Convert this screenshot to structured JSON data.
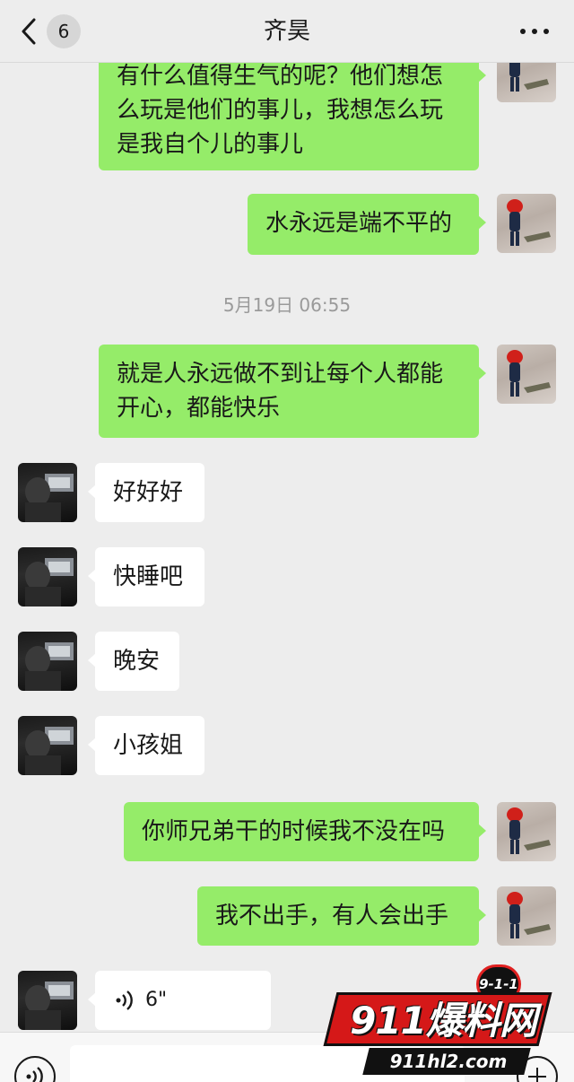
{
  "header": {
    "unread_count": "6",
    "title": "齐昊"
  },
  "messages": [
    {
      "side": "self",
      "text": "有什么值得生气的呢？他们想怎\n么玩是他们的事儿，我想怎么玩\n是我自个儿的事儿"
    },
    {
      "side": "self",
      "text": "水永远是端不平的"
    },
    {
      "type": "time",
      "text": "5月19日 06:55"
    },
    {
      "side": "self",
      "text": "就是人永远做不到让每个人都能\n开心，都能快乐"
    },
    {
      "side": "other",
      "text": "好好好"
    },
    {
      "side": "other",
      "text": "快睡吧"
    },
    {
      "side": "other",
      "text": "晚安"
    },
    {
      "side": "other",
      "text": "小孩姐"
    },
    {
      "side": "self",
      "text": "你师兄弟干的时候我不没在吗"
    },
    {
      "side": "self",
      "text": "我不出手，有人会出手"
    },
    {
      "side": "other",
      "type": "voice",
      "duration": "6\""
    }
  ],
  "watermark": {
    "badge": "9-1-1",
    "logo_text": "911爆料网",
    "url": "911hl2.com"
  },
  "colors": {
    "self_bubble": "#95ec69",
    "other_bubble": "#ffffff",
    "background": "#ededed",
    "watermark_red": "#d51818"
  },
  "icons": [
    "back-chevron-icon",
    "more-dots-icon",
    "voice-wave-icon",
    "voice-input-icon",
    "plus-icon"
  ]
}
